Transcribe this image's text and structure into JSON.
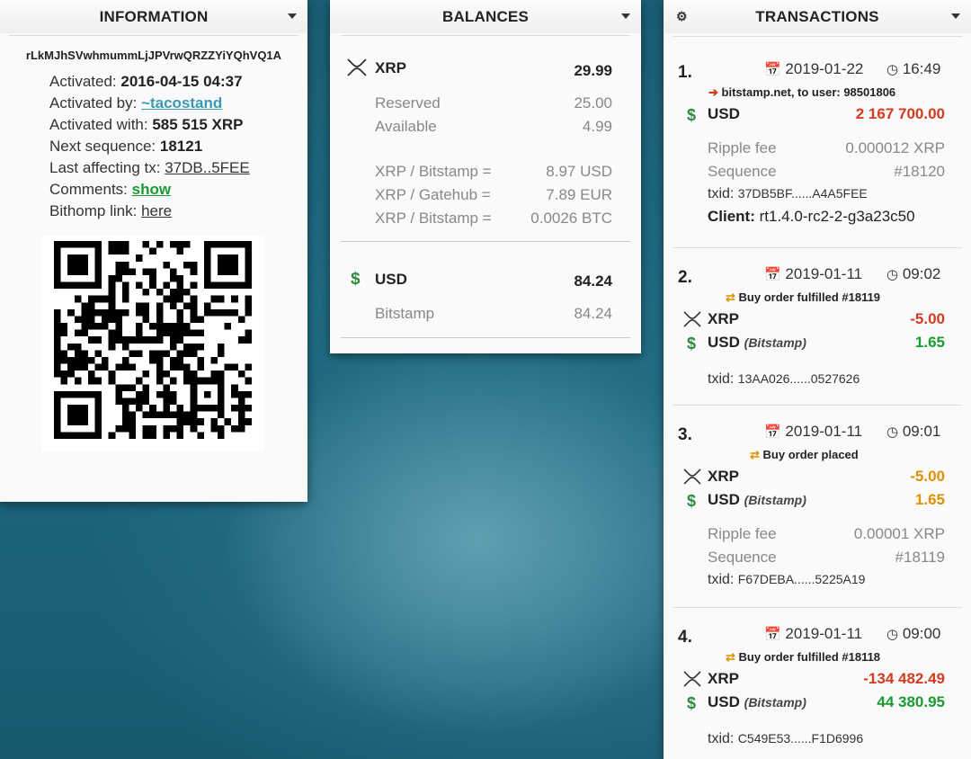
{
  "information": {
    "title": "INFORMATION",
    "address": "rLkMJhSVwhmummLjJPVrwQRZZYiYQhVQ1A",
    "rows": [
      {
        "label": "Activated:",
        "value": "2016-04-15 04:37"
      },
      {
        "label": "Activated by:",
        "value": "~tacostand"
      },
      {
        "label": "Activated with:",
        "value": "585 515 XRP"
      },
      {
        "label": "Next sequence:",
        "value": "18121"
      },
      {
        "label": "Last affecting tx:",
        "value": "37DB..5FEE"
      },
      {
        "label": "Comments:",
        "value": "show"
      },
      {
        "label": "Bithomp link:",
        "value": "here"
      }
    ]
  },
  "balances": {
    "title": "BALANCES",
    "xrp": {
      "currency": "XRP",
      "amount": "29.99",
      "reserved_label": "Reserved",
      "reserved": "25.00",
      "available_label": "Available",
      "available": "4.99",
      "rates": [
        {
          "label": "XRP / Bitstamp =",
          "value": "8.97 USD"
        },
        {
          "label": "XRP / Gatehub =",
          "value": "7.89 EUR"
        },
        {
          "label": "XRP / Bitstamp =",
          "value": "0.0026 BTC"
        }
      ]
    },
    "usd": {
      "currency": "USD",
      "amount": "84.24",
      "issuer": "Bitstamp",
      "issuer_amount": "84.24"
    }
  },
  "transactions": {
    "title": "TRANSACTIONS",
    "items": [
      {
        "num": "1.",
        "date": "2019-01-22",
        "time": "16:49",
        "event": "bitstamp.net, to user: 98501806",
        "lines": [
          {
            "cur": "USD",
            "issuer": "",
            "amount": "2 167 700.00"
          }
        ],
        "fee_label": "Ripple fee",
        "fee": "0.000012 XRP",
        "seq_label": "Sequence",
        "seq": "#18120",
        "txid_label": "txid:",
        "txid": "37DB5BF......A4A5FEE",
        "client_label": "Client:",
        "client": "rt1.4.0-rc2-2-g3a23c50"
      },
      {
        "num": "2.",
        "date": "2019-01-11",
        "time": "09:02",
        "event": "Buy order fulfilled #18119",
        "lines": [
          {
            "cur": "XRP",
            "issuer": "",
            "amount": "-5.00"
          },
          {
            "cur": "USD",
            "issuer": "Bitstamp",
            "amount": "1.65"
          }
        ],
        "txid_label": "txid:",
        "txid": "13AA026......0527626"
      },
      {
        "num": "3.",
        "date": "2019-01-11",
        "time": "09:01",
        "event": "Buy order placed",
        "lines": [
          {
            "cur": "XRP",
            "issuer": "",
            "amount": "-5.00"
          },
          {
            "cur": "USD",
            "issuer": "Bitstamp",
            "amount": "1.65"
          }
        ],
        "fee_label": "Ripple fee",
        "fee": "0.00001 XRP",
        "seq_label": "Sequence",
        "seq": "#18119",
        "txid_label": "txid:",
        "txid": "F67DEBA......5225A19"
      },
      {
        "num": "4.",
        "date": "2019-01-11",
        "time": "09:00",
        "event": "Buy order fulfilled #18118",
        "lines": [
          {
            "cur": "XRP",
            "issuer": "",
            "amount": "-134 482.49"
          },
          {
            "cur": "USD",
            "issuer": "Bitstamp",
            "amount": "44 380.95"
          }
        ],
        "txid_label": "txid:",
        "txid": "C549E53......F1D6996"
      }
    ]
  },
  "colors": {
    "negative": "#d13c20",
    "positive": "#1a9a33",
    "pending": "#e09000",
    "link": "#3a9bb0"
  }
}
